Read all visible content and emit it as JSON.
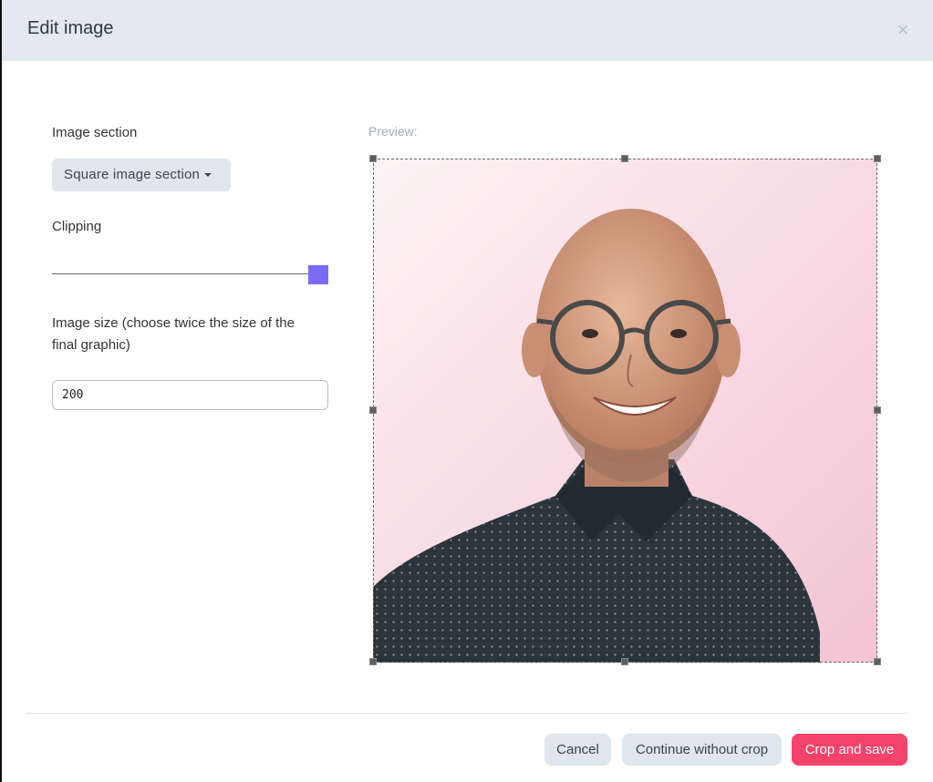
{
  "dialog": {
    "title": "Edit image",
    "close_icon": "×"
  },
  "left_panel": {
    "image_section_label": "Image section",
    "image_section_selected": "Square image section",
    "clipping_label": "Clipping",
    "clipping_level": 1.0,
    "image_size_label_line1": "Image size (choose twice the size of the",
    "image_size_label_line2": "final graphic)",
    "image_size_value": "200"
  },
  "preview": {
    "label": "Preview:",
    "image_subject": "portrait-photo"
  },
  "footer": {
    "cancel_label": "Cancel",
    "continue_label": "Continue without crop",
    "save_label": "Crop and save"
  },
  "colors": {
    "header_bg": "#e2e9f0",
    "slider_handle": "#7b6cf6",
    "primary_button": "#f4426a",
    "secondary_button": "#dfe6ed"
  }
}
